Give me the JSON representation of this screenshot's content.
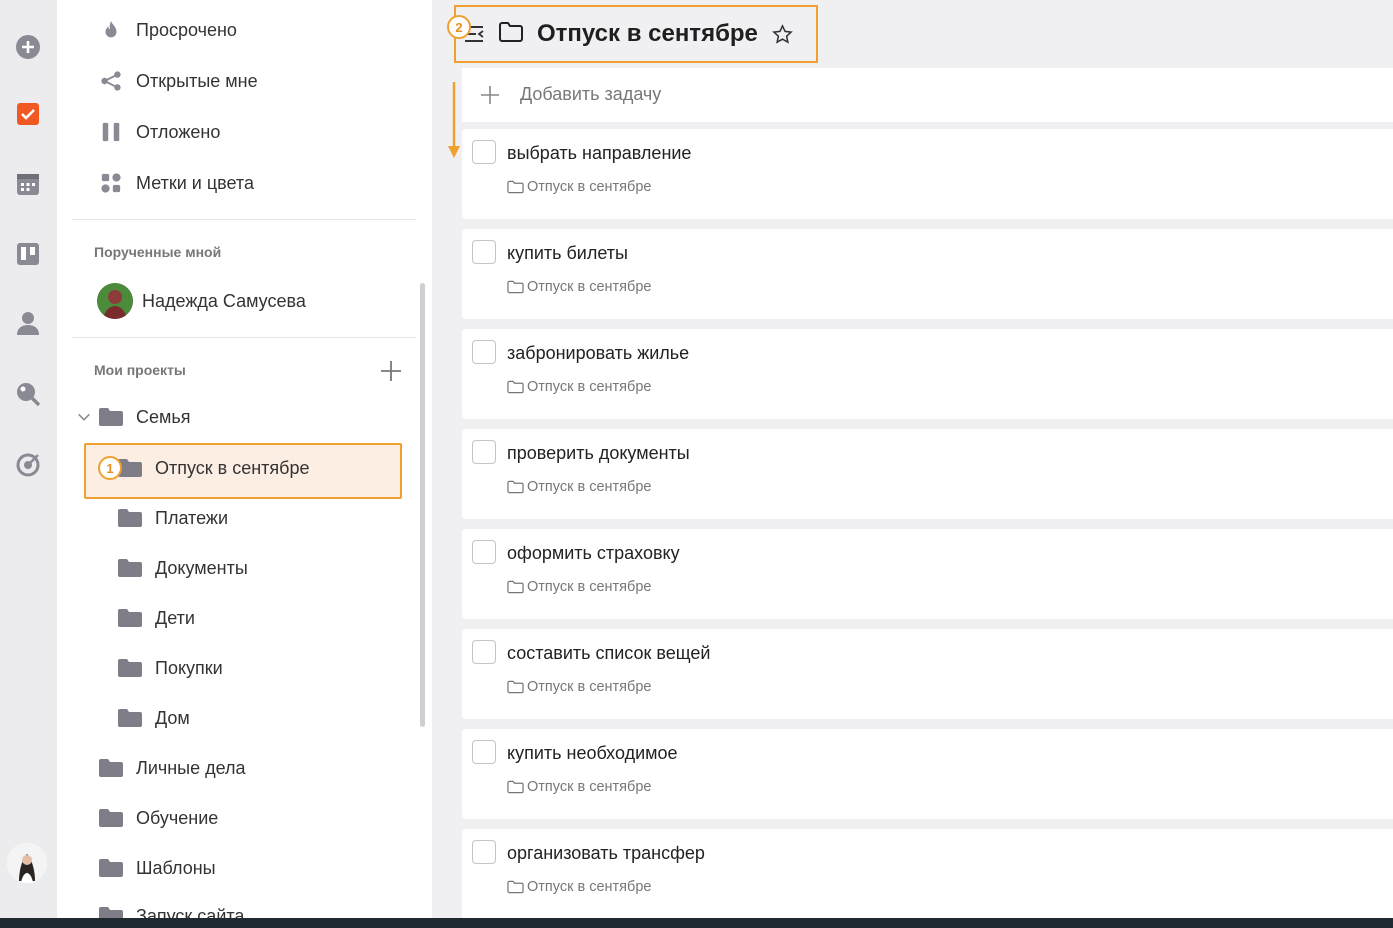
{
  "rail": {
    "icons": [
      "add-icon",
      "tasks-icon",
      "calendar-icon",
      "board-icon",
      "contacts-icon",
      "search-icon",
      "goals-icon"
    ],
    "accent": "#f05a22"
  },
  "sidebar": {
    "nav": [
      {
        "label": "Просрочено",
        "icon": "flame-icon"
      },
      {
        "label": "Открытые мне",
        "icon": "share-icon"
      },
      {
        "label": "Отложено",
        "icon": "pause-icon"
      },
      {
        "label": "Метки и цвета",
        "icon": "tags-icon"
      }
    ],
    "assigned_title": "Порученные мной",
    "assigned_user": "Надежда Самусева",
    "projects_title": "Мои проекты",
    "projects": {
      "group": "Семья",
      "children": [
        "Отпуск в сентябре",
        "Платежи",
        "Документы",
        "Дети",
        "Покупки",
        "Дом"
      ],
      "others": [
        "Личные дела",
        "Обучение",
        "Шаблоны",
        "Запуск сайта"
      ]
    },
    "annotation_1": "1"
  },
  "main": {
    "title": "Отпуск в сентябре",
    "add_task": "Добавить задачу",
    "annotation_2": "2",
    "tasks": [
      {
        "title": "выбрать направление",
        "project": "Отпуск в сентябре"
      },
      {
        "title": "купить билеты",
        "project": "Отпуск в сентябре"
      },
      {
        "title": "забронировать жилье",
        "project": "Отпуск в сентябре"
      },
      {
        "title": "проверить документы",
        "project": "Отпуск в сентябре"
      },
      {
        "title": "оформить страховку",
        "project": "Отпуск в сентябре"
      },
      {
        "title": "составить список вещей",
        "project": "Отпуск в сентябре"
      },
      {
        "title": "купить необходимое",
        "project": "Отпуск в сентябре"
      },
      {
        "title": "организовать трансфер",
        "project": "Отпуск в сентябре"
      }
    ]
  },
  "colors": {
    "highlight": "#f0a030",
    "folder": "#7e7d88"
  }
}
